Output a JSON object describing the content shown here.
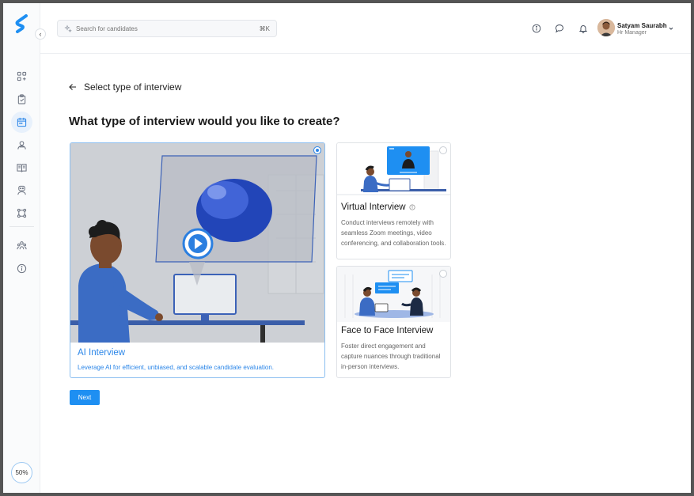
{
  "sidebar": {
    "progress": "50%",
    "items": [
      {
        "name": "dashboard-icon"
      },
      {
        "name": "clipboard-check-icon"
      },
      {
        "name": "calendar-icon"
      },
      {
        "name": "users-icon"
      },
      {
        "name": "book-icon"
      },
      {
        "name": "user-badge-icon"
      },
      {
        "name": "workflow-icon"
      },
      {
        "name": "team-icon"
      },
      {
        "name": "info-icon"
      }
    ]
  },
  "header": {
    "search_placeholder": "Search for candidates",
    "search_shortcut": "⌘K",
    "user_name": "Satyam Saurabh",
    "user_role": "Hr Manager"
  },
  "main": {
    "back_title": "Select type of interview",
    "question": "What type of interview would you like to create?",
    "cards": [
      {
        "title": "AI Interview",
        "description": "Leverage AI for efficient, unbiased, and scalable candidate evaluation.",
        "selected": true
      },
      {
        "title": "Virtual Interview",
        "description": "Conduct interviews remotely with seamless Zoom meetings, video conferencing, and collaboration tools.",
        "selected": false
      },
      {
        "title": "Face to Face Interview",
        "description": "Foster direct engagement and capture nuances through traditional in-person interviews.",
        "selected": false
      }
    ],
    "next_label": "Next"
  },
  "colors": {
    "accent": "#1e8ff2",
    "selected_border": "#8bbef0"
  }
}
